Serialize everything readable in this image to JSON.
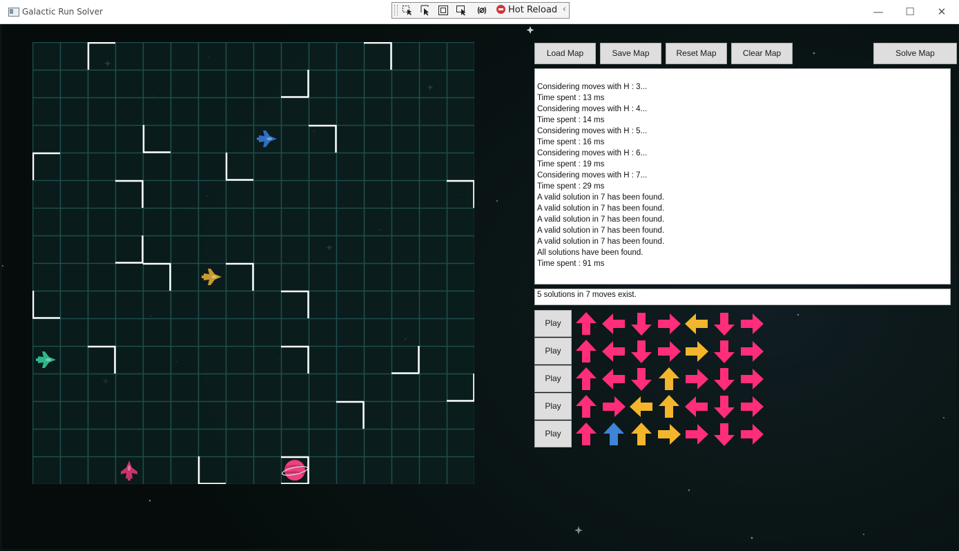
{
  "window": {
    "title": "Galactic Run Solver",
    "minimize_glyph": "—",
    "maximize_glyph": "☐",
    "close_glyph": "✕"
  },
  "debug_toolbar": {
    "hot_reload_label": "Hot Reload",
    "collapse_glyph": "‹",
    "icons": [
      "select-element-icon",
      "pointer-icon",
      "display-layout-adorners-icon",
      "track-focused-element-icon",
      "binding-failures-icon"
    ]
  },
  "toolbar": {
    "load_label": "Load Map",
    "save_label": "Save Map",
    "reset_label": "Reset Map",
    "clear_label": "Clear Map",
    "solve_label": "Solve Map"
  },
  "log": {
    "lines": [
      "Considering moves with H : 3...",
      "Time spent : 13 ms",
      "Considering moves with H : 4...",
      "Time spent : 14 ms",
      "Considering moves with H : 5...",
      "Time spent : 16 ms",
      "Considering moves with H : 6...",
      "Time spent : 19 ms",
      "Considering moves with H : 7...",
      "Time spent : 29 ms",
      "A valid solution in 7 has been found.",
      "A valid solution in 7 has been found.",
      "A valid solution in 7 has been found.",
      "A valid solution in 7 has been found.",
      "A valid solution in 7 has been found.",
      "All solutions have been found.",
      "Time spent : 91 ms"
    ]
  },
  "summary": "5 solutions in 7 moves exist.",
  "play_label": "Play",
  "colors": {
    "pink": "#ff2d7a",
    "gold": "#f2b52c",
    "blue": "#3f84d6",
    "grid_line": "#1f4d4d",
    "cell_bg": "#0b1e1e",
    "wall": "#ffffff",
    "ship_blue": "#2f6fc4",
    "ship_gold": "#c89a2e",
    "ship_green": "#2fb58a",
    "ship_pink": "#c8326e",
    "planet": "#ee3f7e"
  },
  "solutions": [
    {
      "moves": [
        {
          "dir": "up",
          "color": "pink"
        },
        {
          "dir": "left",
          "color": "pink"
        },
        {
          "dir": "down",
          "color": "pink"
        },
        {
          "dir": "right",
          "color": "pink"
        },
        {
          "dir": "left",
          "color": "gold"
        },
        {
          "dir": "down",
          "color": "pink"
        },
        {
          "dir": "right",
          "color": "pink"
        }
      ]
    },
    {
      "moves": [
        {
          "dir": "up",
          "color": "pink"
        },
        {
          "dir": "left",
          "color": "pink"
        },
        {
          "dir": "down",
          "color": "pink"
        },
        {
          "dir": "right",
          "color": "pink"
        },
        {
          "dir": "right",
          "color": "gold"
        },
        {
          "dir": "down",
          "color": "pink"
        },
        {
          "dir": "right",
          "color": "pink"
        }
      ]
    },
    {
      "moves": [
        {
          "dir": "up",
          "color": "pink"
        },
        {
          "dir": "left",
          "color": "pink"
        },
        {
          "dir": "down",
          "color": "pink"
        },
        {
          "dir": "up",
          "color": "gold"
        },
        {
          "dir": "right",
          "color": "pink"
        },
        {
          "dir": "down",
          "color": "pink"
        },
        {
          "dir": "right",
          "color": "pink"
        }
      ]
    },
    {
      "moves": [
        {
          "dir": "up",
          "color": "pink"
        },
        {
          "dir": "right",
          "color": "pink"
        },
        {
          "dir": "left",
          "color": "gold"
        },
        {
          "dir": "up",
          "color": "gold"
        },
        {
          "dir": "left",
          "color": "pink"
        },
        {
          "dir": "down",
          "color": "pink"
        },
        {
          "dir": "right",
          "color": "pink"
        }
      ]
    },
    {
      "moves": [
        {
          "dir": "up",
          "color": "pink"
        },
        {
          "dir": "up",
          "color": "blue"
        },
        {
          "dir": "up",
          "color": "gold"
        },
        {
          "dir": "right",
          "color": "gold"
        },
        {
          "dir": "right",
          "color": "pink"
        },
        {
          "dir": "down",
          "color": "pink"
        },
        {
          "dir": "right",
          "color": "pink"
        }
      ]
    }
  ],
  "board": {
    "rows": 16,
    "cols": 16,
    "walls": [
      {
        "r": 0,
        "c": 2,
        "s": "top"
      },
      {
        "r": 0,
        "c": 2,
        "s": "left"
      },
      {
        "r": 0,
        "c": 12,
        "s": "top"
      },
      {
        "r": 0,
        "c": 12,
        "s": "right"
      },
      {
        "r": 1,
        "c": 9,
        "s": "bottom"
      },
      {
        "r": 1,
        "c": 9,
        "s": "right"
      },
      {
        "r": 3,
        "c": 4,
        "s": "left"
      },
      {
        "r": 3,
        "c": 4,
        "s": "bottom"
      },
      {
        "r": 3,
        "c": 10,
        "s": "top"
      },
      {
        "r": 3,
        "c": 10,
        "s": "right"
      },
      {
        "r": 4,
        "c": 0,
        "s": "top"
      },
      {
        "r": 4,
        "c": 0,
        "s": "left"
      },
      {
        "r": 4,
        "c": 7,
        "s": "left"
      },
      {
        "r": 4,
        "c": 7,
        "s": "bottom"
      },
      {
        "r": 5,
        "c": 3,
        "s": "top"
      },
      {
        "r": 5,
        "c": 3,
        "s": "right"
      },
      {
        "r": 5,
        "c": 15,
        "s": "top"
      },
      {
        "r": 5,
        "c": 15,
        "s": "right"
      },
      {
        "r": 7,
        "c": 3,
        "s": "bottom"
      },
      {
        "r": 7,
        "c": 3,
        "s": "right"
      },
      {
        "r": 8,
        "c": 4,
        "s": "top"
      },
      {
        "r": 8,
        "c": 4,
        "s": "right"
      },
      {
        "r": 8,
        "c": 7,
        "s": "top"
      },
      {
        "r": 8,
        "c": 7,
        "s": "right"
      },
      {
        "r": 9,
        "c": 0,
        "s": "left"
      },
      {
        "r": 9,
        "c": 0,
        "s": "bottom"
      },
      {
        "r": 9,
        "c": 9,
        "s": "top"
      },
      {
        "r": 9,
        "c": 9,
        "s": "right"
      },
      {
        "r": 11,
        "c": 2,
        "s": "top"
      },
      {
        "r": 11,
        "c": 2,
        "s": "right"
      },
      {
        "r": 11,
        "c": 9,
        "s": "top"
      },
      {
        "r": 11,
        "c": 9,
        "s": "right"
      },
      {
        "r": 11,
        "c": 13,
        "s": "right"
      },
      {
        "r": 11,
        "c": 13,
        "s": "bottom"
      },
      {
        "r": 12,
        "c": 15,
        "s": "right"
      },
      {
        "r": 12,
        "c": 15,
        "s": "bottom"
      },
      {
        "r": 13,
        "c": 11,
        "s": "top"
      },
      {
        "r": 13,
        "c": 11,
        "s": "right"
      },
      {
        "r": 15,
        "c": 6,
        "s": "left"
      },
      {
        "r": 15,
        "c": 6,
        "s": "bottom"
      },
      {
        "r": 15,
        "c": 9,
        "s": "top"
      },
      {
        "r": 15,
        "c": 9,
        "s": "right"
      },
      {
        "r": 15,
        "c": 9,
        "s": "bottom"
      }
    ],
    "ships": [
      {
        "name": "blue-ship",
        "r": 3,
        "c": 8,
        "color": "ship_blue",
        "facing": "right"
      },
      {
        "name": "gold-ship",
        "r": 8,
        "c": 6,
        "color": "ship_gold",
        "facing": "right"
      },
      {
        "name": "green-ship",
        "r": 11,
        "c": 0,
        "color": "ship_green",
        "facing": "right"
      },
      {
        "name": "pink-ship",
        "r": 15,
        "c": 3,
        "color": "ship_pink",
        "facing": "up"
      }
    ],
    "target": {
      "name": "target-planet",
      "r": 15,
      "c": 9
    }
  }
}
